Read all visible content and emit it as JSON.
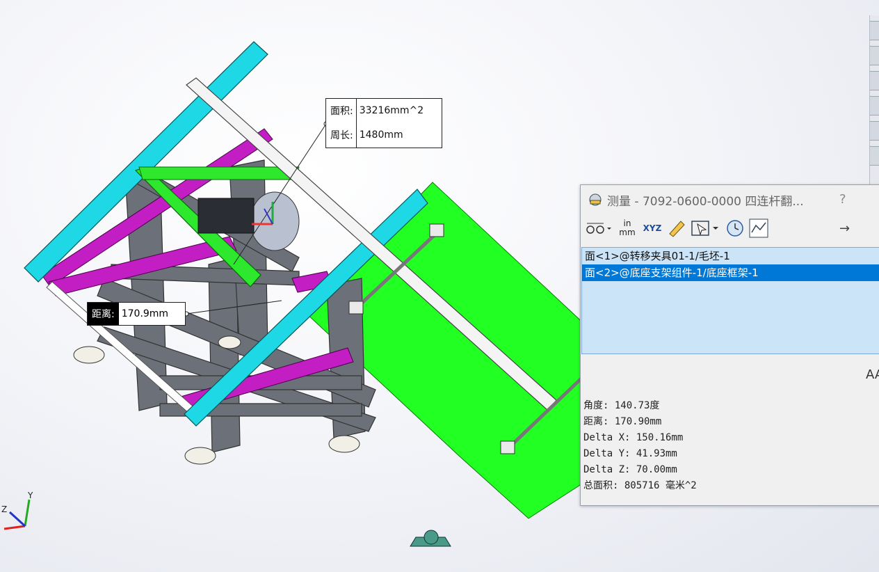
{
  "face_callout": {
    "area_label": "面积:",
    "area_value": "33216mm^2",
    "perimeter_label": "周长:",
    "perimeter_value": "1480mm"
  },
  "distance_callout": {
    "label": "距离:",
    "value": "170.9mm"
  },
  "measure_panel": {
    "title": "测量 - 7092-0600-0000 四连杆翻...",
    "help": "?",
    "toolbar": {
      "units_top": "in",
      "units_bottom": "mm",
      "xyz_label": "XYZ",
      "arrow": "→"
    },
    "selections": [
      "面<1>@转移夹具01-1/毛坯-1",
      "面<2>@底座支架组件-1/底座框架-1"
    ],
    "aa_label": "AA",
    "results": [
      "角度: 140.73度",
      "距离: 170.90mm",
      "Delta X: 150.16mm",
      "Delta Y: 41.93mm",
      "Delta Z: 70.00mm",
      "总面积: 805716 毫米^2"
    ]
  },
  "triad": {
    "y_label": "Y",
    "z_label": "Z"
  },
  "colors": {
    "cyan_rail": "#1fd8e6",
    "magenta_link": "#c21ec4",
    "green_face": "#22ff22",
    "frame_gray": "#6c7078",
    "selection_blue": "#0078d7",
    "list_bg": "#cce4f7"
  }
}
